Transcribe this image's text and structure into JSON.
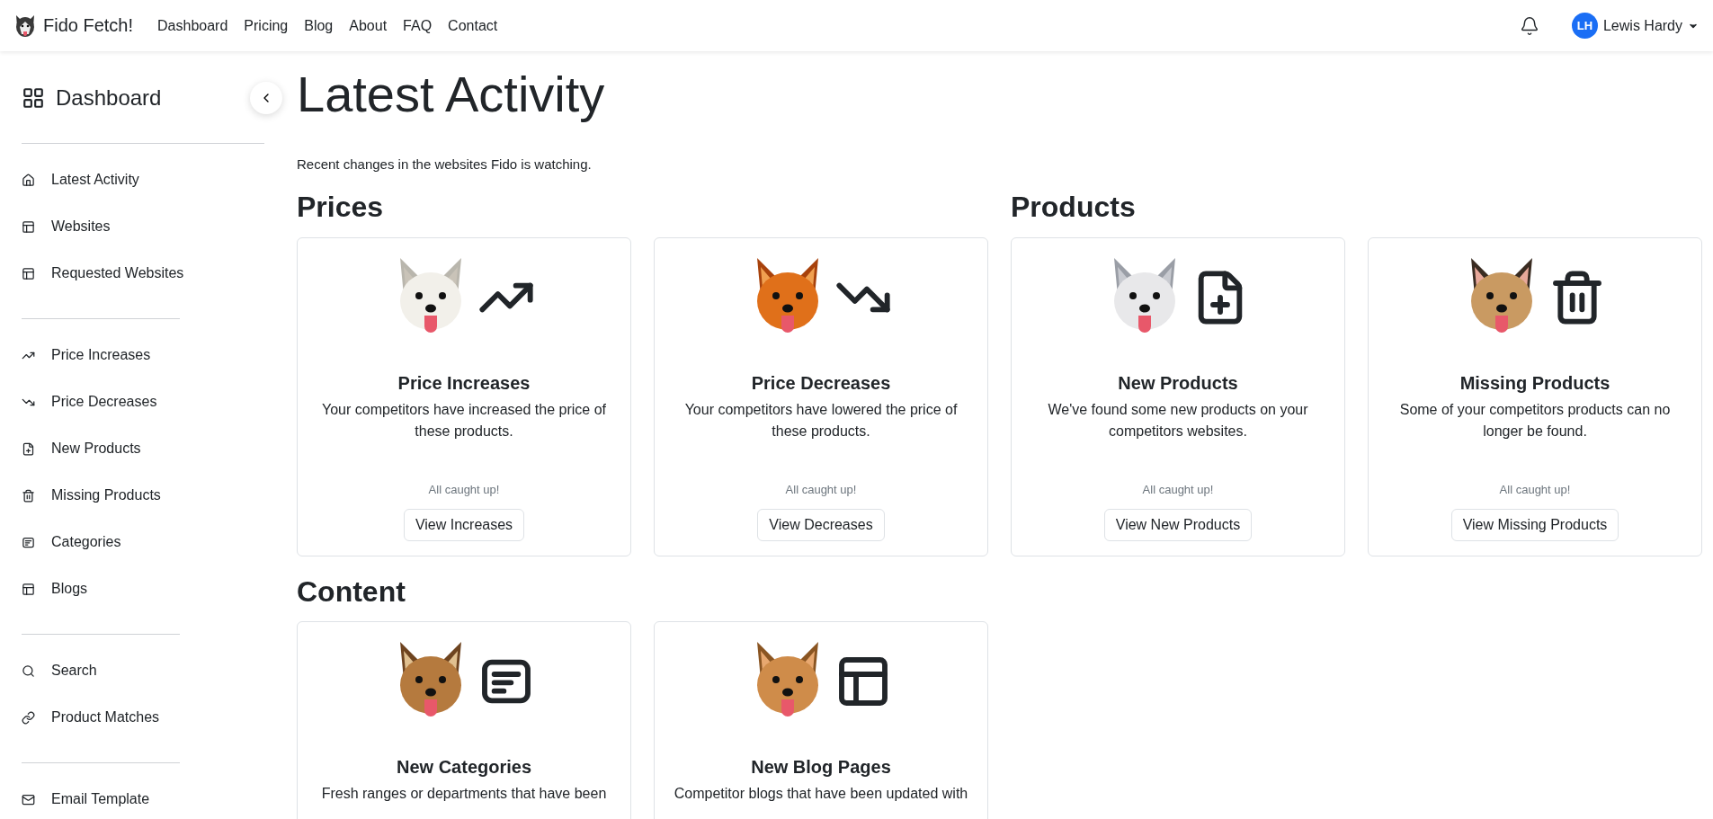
{
  "navbar": {
    "brand": "Fido Fetch!",
    "links": [
      "Dashboard",
      "Pricing",
      "Blog",
      "About",
      "FAQ",
      "Contact"
    ],
    "user": {
      "initials": "LH",
      "name": "Lewis Hardy"
    }
  },
  "sidebar": {
    "title": "Dashboard",
    "groups": [
      {
        "items": [
          {
            "label": "Latest Activity",
            "kind": "home"
          },
          {
            "label": "Websites",
            "kind": "layout"
          },
          {
            "label": "Requested Websites",
            "kind": "layout"
          }
        ]
      },
      {
        "items": [
          {
            "label": "Price Increases",
            "kind": "up"
          },
          {
            "label": "Price Decreases",
            "kind": "down"
          },
          {
            "label": "New Products",
            "kind": "file"
          },
          {
            "label": "Missing Products",
            "kind": "trash"
          },
          {
            "label": "Categories",
            "kind": "list"
          },
          {
            "label": "Blogs",
            "kind": "layout"
          }
        ]
      },
      {
        "items": [
          {
            "label": "Search",
            "kind": "search"
          },
          {
            "label": "Product Matches",
            "kind": "link"
          }
        ]
      },
      {
        "items": [
          {
            "label": "Email Template",
            "kind": "mail"
          }
        ]
      }
    ]
  },
  "main": {
    "title": "Latest Activity",
    "subtitle": "Recent changes in the websites Fido is watching.",
    "sections": [
      {
        "heading": "Prices",
        "cards": [
          {
            "kind": "up",
            "title": "Price Increases",
            "description": "Your competitors have increased the price of these products.",
            "status": "All caught up!",
            "button": "View Increases"
          },
          {
            "kind": "down",
            "title": "Price Decreases",
            "description": "Your competitors have lowered the price of these products.",
            "status": "All caught up!",
            "button": "View Decreases"
          }
        ]
      },
      {
        "heading": "Products",
        "cards": [
          {
            "kind": "file",
            "title": "New Products",
            "description": "We've found some new products on your competitors websites.",
            "status": "All caught up!",
            "button": "View New Products"
          },
          {
            "kind": "trash",
            "title": "Missing Products",
            "description": "Some of your competitors products can no longer be found.",
            "status": "All caught up!",
            "button": "View Missing Products"
          }
        ]
      },
      {
        "heading": "Content",
        "cards": [
          {
            "kind": "list",
            "title": "New Categories",
            "description": "Fresh ranges or departments that have been"
          },
          {
            "kind": "layout",
            "title": "New Blog Pages",
            "description": "Competitor blogs that have been updated with"
          }
        ]
      }
    ]
  }
}
